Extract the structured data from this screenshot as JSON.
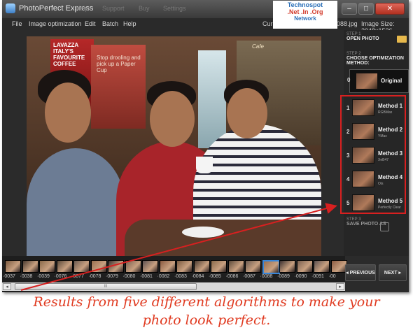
{
  "window": {
    "title": "PhotoPerfect Express",
    "ghost_menu": [
      "Help",
      "Support",
      "Buy",
      "Settings"
    ],
    "controls": {
      "minimize": "–",
      "maximize": "□",
      "close": "✕"
    }
  },
  "menu": {
    "items": [
      "File",
      "Image optimization",
      "Edit",
      "Batch",
      "Help"
    ],
    "current_filename": "Current Filename: Photo-0088.jpg",
    "image_size": "Image Size: 2048x1536"
  },
  "watermark": {
    "line1": "Technospot",
    "line2": ".Net .In .Org",
    "line3": "Network"
  },
  "photo": {
    "poster_text": "LAVAZZA ITALY'S FAVOURITE COFFEE",
    "poster2_text": "Stop drooling and pick up a Paper Cup",
    "shelf_text": "Cafe"
  },
  "panel": {
    "step1_label": "STEP 1",
    "step1_title": "OPEN PHOTO",
    "step2_label": "STEP 2",
    "step2_title": "CHOOSE OPTIMIZATION METHOD:",
    "original": {
      "num": "0",
      "name": "Original"
    },
    "methods": [
      {
        "num": "1",
        "name": "Method 1",
        "sub": "RGBMax"
      },
      {
        "num": "2",
        "name": "Method 2",
        "sub": "YMax"
      },
      {
        "num": "3",
        "name": "Method 3",
        "sub": "XeB47"
      },
      {
        "num": "4",
        "name": "Method 4",
        "sub": "Ois"
      },
      {
        "num": "5",
        "name": "Method 5",
        "sub": "Perfectly Clear"
      }
    ],
    "step3_label": "STEP 3",
    "step3_title": "SAVE PHOTO AS"
  },
  "filmstrip": {
    "labels": [
      "·0037",
      "·0038",
      "·0039",
      "·0076",
      "·0077",
      "·0078",
      "·0079",
      "·0080",
      "·0081",
      "·0082",
      "·0083",
      "·0084",
      "·0085",
      "·0086",
      "·0087",
      "·0088",
      "·0089",
      "·0090",
      "·0091",
      "·00"
    ],
    "selected_index": 15,
    "scroll_grip": "III",
    "scroll_left": "◂",
    "scroll_right": "▸"
  },
  "nav": {
    "previous": "◂ PREVIOUS",
    "next": "NEXT ▸"
  },
  "caption": {
    "line1": "Results from five different algorithms to make your",
    "line2": "photo look perfect."
  },
  "colors": {
    "accent_red": "#d82020",
    "selection_blue": "#3a86d8",
    "caption_red": "#e03a20"
  }
}
